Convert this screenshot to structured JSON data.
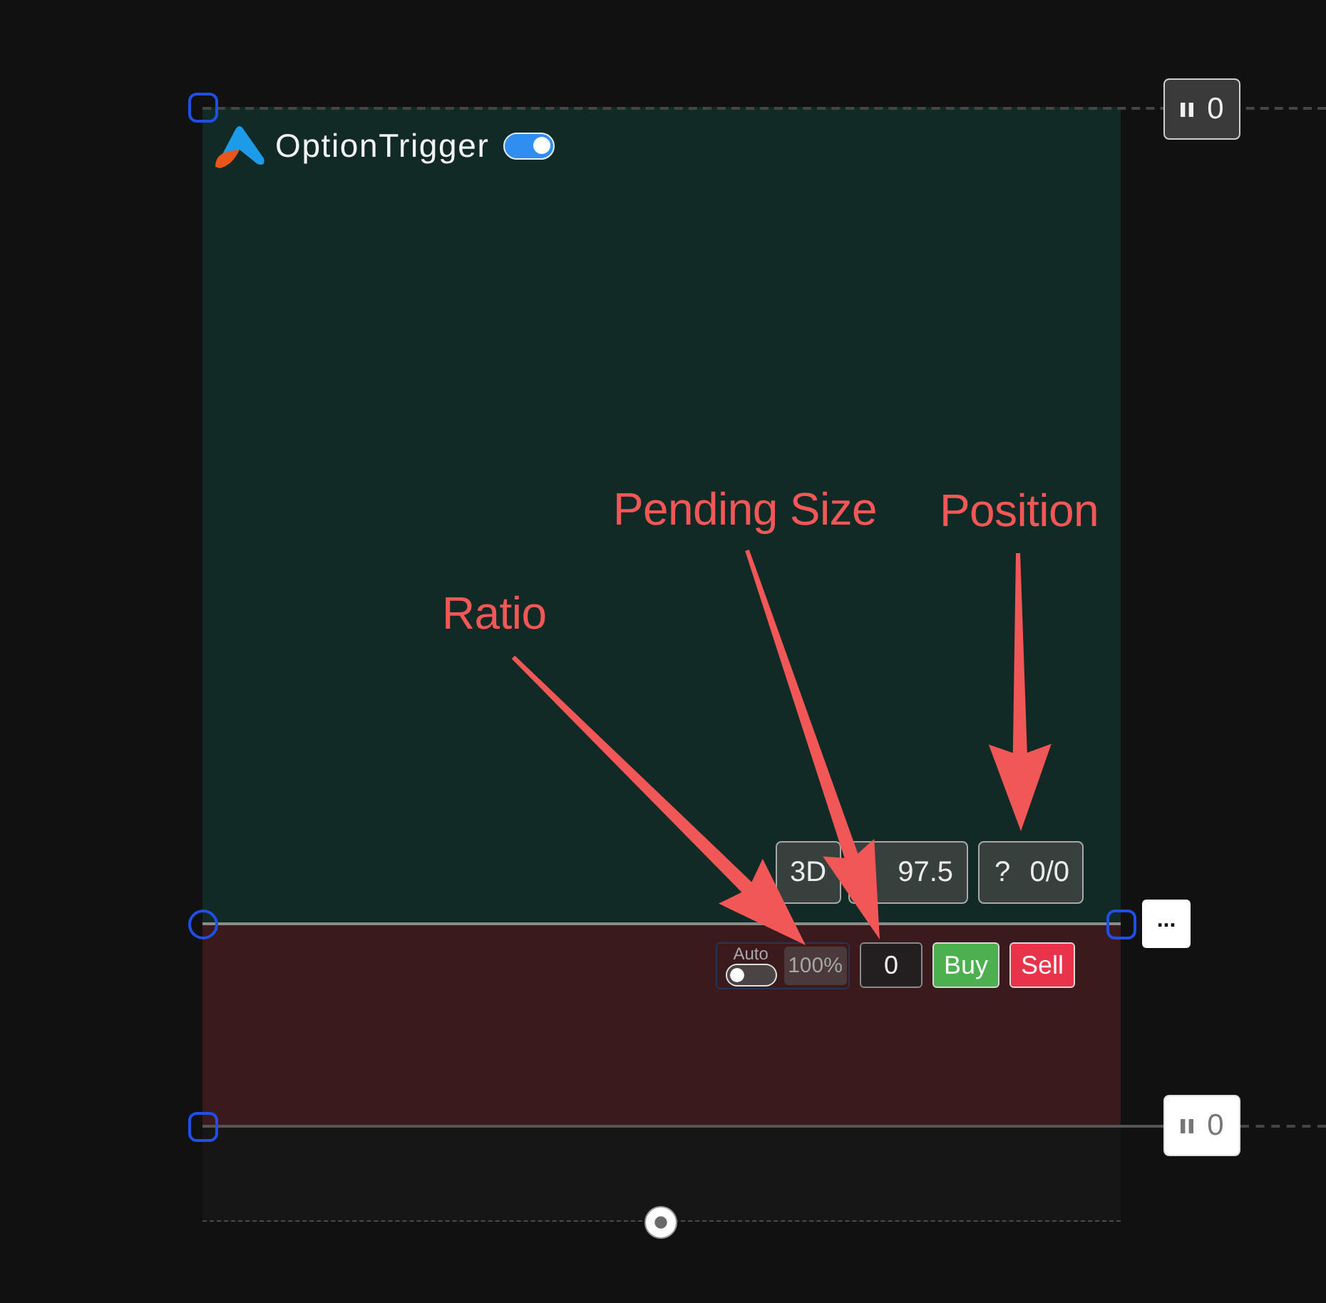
{
  "header": {
    "title": "OptionTrigger",
    "enabled": true
  },
  "price_tags": [
    {
      "value": "0",
      "kind": "dark"
    },
    {
      "value": "0",
      "kind": "light"
    }
  ],
  "info_boxes": [
    {
      "text": "3D"
    },
    {
      "text": "97.5"
    },
    {
      "text": "? 0/0"
    }
  ],
  "order_bar": {
    "auto_label": "Auto",
    "auto": false,
    "ratio": "100%",
    "size": "0",
    "buttons": [
      {
        "label": "Buy",
        "kind": "buy"
      },
      {
        "label": "Sell",
        "kind": "sell"
      }
    ]
  },
  "more_button": {
    "label": "..."
  },
  "annotations": [
    {
      "label": "Ratio"
    },
    {
      "label": "Pending Size"
    },
    {
      "label": "Position"
    }
  ]
}
